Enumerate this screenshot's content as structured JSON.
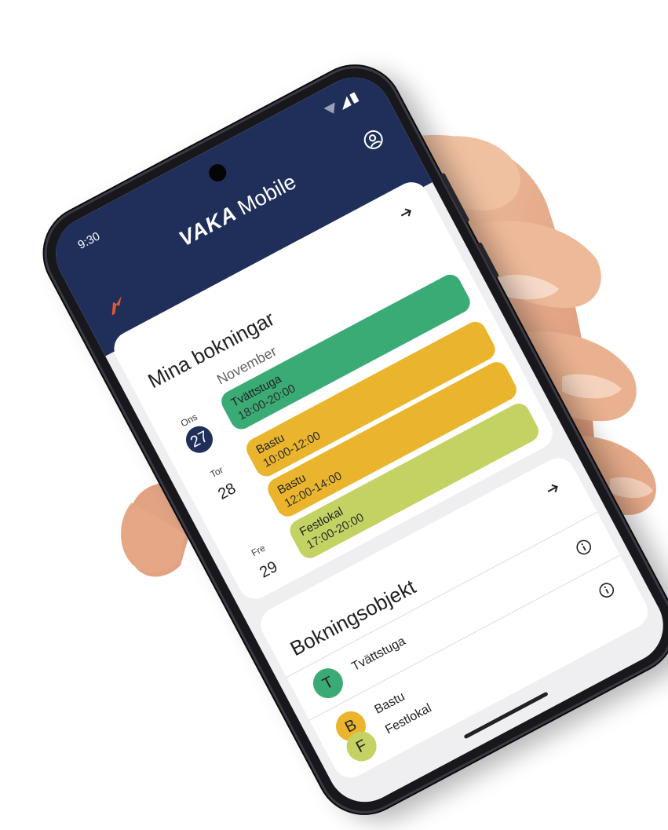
{
  "status_bar": {
    "time": "9:30"
  },
  "header": {
    "brand": "VAKA",
    "product": "Mobile"
  },
  "bookings": {
    "title": "Mina bokningar",
    "month": "November",
    "days": [
      {
        "dow": "Ons",
        "num": "27"
      },
      {
        "dow": "Tor",
        "num": "28"
      },
      {
        "dow": "Fre",
        "num": "29"
      }
    ],
    "items": [
      {
        "name": "Tvättstuga",
        "time": "18:00-20:00",
        "color": "#3aab74"
      },
      {
        "name": "Bastu",
        "time": "10:00-12:00",
        "color": "#eab52c"
      },
      {
        "name": "Bastu",
        "time": "12:00-14:00",
        "color": "#eab52c"
      },
      {
        "name": "Festlokal",
        "time": "17:00-20:00",
        "color": "#c3d262"
      }
    ]
  },
  "objects": {
    "title": "Bokningsobjekt",
    "items": [
      {
        "letter": "T",
        "name": "Tvättstuga",
        "color": "#3aab74"
      },
      {
        "letter": "B",
        "name": "Bastu",
        "color": "#eab52c"
      },
      {
        "letter": "F",
        "name": "Festlokal",
        "color": "#c3d262"
      }
    ]
  },
  "theme": {
    "header_bg": "#1f2f5a",
    "accent": "#e8562b"
  },
  "icons": [
    "wifi-icon",
    "signal-icon",
    "battery-icon",
    "profile-icon",
    "arrow-right-icon",
    "info-icon",
    "vaka-logo-icon"
  ]
}
